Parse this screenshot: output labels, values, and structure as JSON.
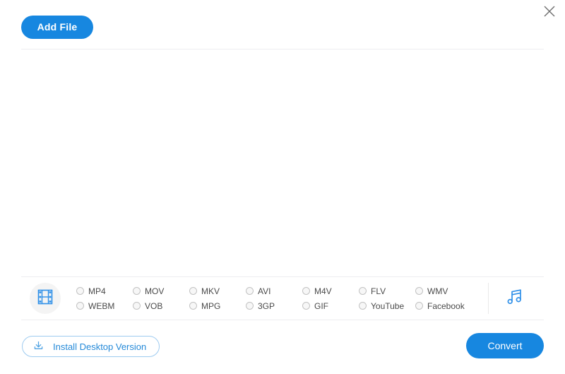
{
  "header": {
    "add_file_label": "Add File",
    "close_icon": "close-icon"
  },
  "formats_panel": {
    "video_icon": "film-strip-icon",
    "audio_icon": "music-note-icon",
    "row1": [
      {
        "label": "MP4",
        "selected": false
      },
      {
        "label": "MOV",
        "selected": false
      },
      {
        "label": "MKV",
        "selected": false
      },
      {
        "label": "AVI",
        "selected": false
      },
      {
        "label": "M4V",
        "selected": false
      },
      {
        "label": "FLV",
        "selected": false
      },
      {
        "label": "WMV",
        "selected": false
      }
    ],
    "row2": [
      {
        "label": "WEBM",
        "selected": false
      },
      {
        "label": "VOB",
        "selected": false
      },
      {
        "label": "MPG",
        "selected": false
      },
      {
        "label": "3GP",
        "selected": false
      },
      {
        "label": "GIF",
        "selected": false
      },
      {
        "label": "YouTube",
        "selected": false
      },
      {
        "label": "Facebook",
        "selected": false
      }
    ]
  },
  "footer": {
    "install_label": "Install Desktop Version",
    "install_icon": "download-icon",
    "convert_label": "Convert"
  },
  "colors": {
    "accent_blue": "#1787e0",
    "icon_blue": "#2e8fe8",
    "outline_blue": "#9ecbf0",
    "divider": "#ededf0",
    "label_text": "#4a4a4a"
  }
}
